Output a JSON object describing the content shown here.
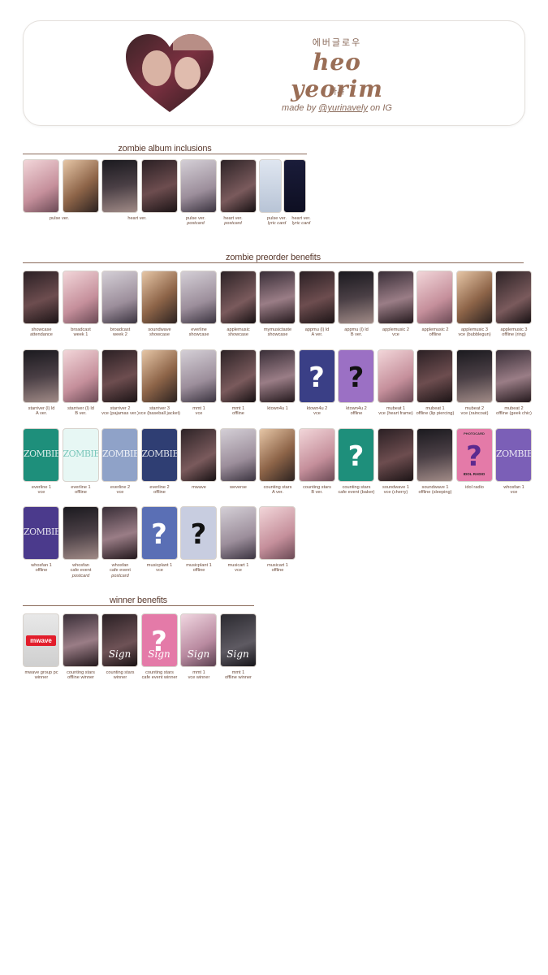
{
  "header": {
    "korean_top": "에버글로우",
    "name": "heo yeorim",
    "korean_bottom": "아샤",
    "made_by_prefix": "made by ",
    "made_by_handle": "@yurinavely",
    "made_by_suffix": " on IG"
  },
  "sections": {
    "album": "zombie album inclusions",
    "preorder": "zombie preorder benefits",
    "winner": "winner benefits"
  },
  "album_captions": [
    {
      "label": "pulse ver.",
      "sub": ""
    },
    {
      "label": "heart ver.",
      "sub": ""
    },
    {
      "label": "pulse ver.",
      "sub": "postcard"
    },
    {
      "label": "heart ver.",
      "sub": "postcard"
    },
    {
      "label": "pulse ver.",
      "sub": "lyric card"
    },
    {
      "label": "heart ver.",
      "sub": "lyric card"
    }
  ],
  "preorder_rows": [
    [
      {
        "l1": "showcase",
        "l2": "attendance"
      },
      {
        "l1": "broadcast",
        "l2": "week 1"
      },
      {
        "l1": "broadcast",
        "l2": "week 2"
      },
      {
        "l1": "soundwave",
        "l2": "showcase"
      },
      {
        "l1": "everline",
        "l2": "showcase"
      },
      {
        "l1": "applemusic",
        "l2": "showcase"
      },
      {
        "l1": "mymusictaste",
        "l2": "showcase"
      },
      {
        "l1": "appmu (l) ld",
        "l2": "A ver."
      },
      {
        "l1": "appmu (l) ld",
        "l2": "B ver."
      },
      {
        "l1": "applemusic 2",
        "l2": "vce"
      },
      {
        "l1": "applemusic 2",
        "l2": "offline"
      },
      {
        "l1": "applemusic 3",
        "l2": "vce (bubblegun)"
      },
      {
        "l1": "applemusic 3",
        "l2": "offline (ring)"
      }
    ],
    [
      {
        "l1": "starriver (l) ld",
        "l2": "A ver."
      },
      {
        "l1": "starriver (l) ld",
        "l2": "B ver."
      },
      {
        "l1": "starriver 2",
        "l2": "vce (pajamas ver.)"
      },
      {
        "l1": "starriver 3",
        "l2": "vce (baseball jacket)"
      },
      {
        "l1": "mmt 1",
        "l2": "vce"
      },
      {
        "l1": "mmt 1",
        "l2": "offline"
      },
      {
        "l1": "ktown4u 1",
        "l2": ""
      },
      {
        "l1": "ktown4u 2",
        "l2": "vce"
      },
      {
        "l1": "ktown4u 2",
        "l2": "offline"
      },
      {
        "l1": "mubeat 1",
        "l2": "vce (heart frame)"
      },
      {
        "l1": "mubeat 1",
        "l2": "offline (lip piercing)"
      },
      {
        "l1": "mubeat 2",
        "l2": "vce (raincoat)"
      },
      {
        "l1": "mubeat 2",
        "l2": "offline (geek chic)"
      }
    ],
    [
      {
        "l1": "everline 1",
        "l2": "vce"
      },
      {
        "l1": "everline 1",
        "l2": "offline"
      },
      {
        "l1": "everline 2",
        "l2": "vce"
      },
      {
        "l1": "everline 2",
        "l2": "offline"
      },
      {
        "l1": "mwave",
        "l2": ""
      },
      {
        "l1": "weverse",
        "l2": ""
      },
      {
        "l1": "counting stars",
        "l2": "A ver."
      },
      {
        "l1": "counting stars",
        "l2": "B ver."
      },
      {
        "l1": "counting stars",
        "l2": "cafe event (baker)"
      },
      {
        "l1": "soundwave 1",
        "l2": "vce (cherry)"
      },
      {
        "l1": "soundwave 1",
        "l2": "offline (sleeping)"
      },
      {
        "l1": "idol radio",
        "l2": ""
      },
      {
        "l1": "whosfan 1",
        "l2": "vce"
      }
    ],
    [
      {
        "l1": "whosfan 1",
        "l2": "offline"
      },
      {
        "l1": "whosfan",
        "l2": "cafe event",
        "l3": "postcard"
      },
      {
        "l1": "whosfan",
        "l2": "cafe event",
        "l3": "postcard"
      },
      {
        "l1": "musicplant 1",
        "l2": "vce"
      },
      {
        "l1": "musicplant 1",
        "l2": "offline"
      },
      {
        "l1": "musicart 1",
        "l2": "vce"
      },
      {
        "l1": "musicart 1",
        "l2": "offline"
      }
    ]
  ],
  "winner_captions": [
    {
      "l1": "mwave group pc",
      "l2": "winner"
    },
    {
      "l1": "counting stars",
      "l2": "offline winner"
    },
    {
      "l1": "counting stars",
      "l2": "winner"
    },
    {
      "l1": "counting stars",
      "l2": "cafe event winner"
    },
    {
      "l1": "mmt 1",
      "l2": "vce winner"
    },
    {
      "l1": "mmt 1",
      "l2": "offline winner"
    }
  ],
  "card_texts": {
    "question": "?",
    "zombie": "ZOMBIE",
    "sign": "Sign",
    "mwave": "mwave",
    "photocard": "PHOTOCARD",
    "idol_radio": "IDOL RADIO"
  },
  "colors": {
    "accent_brown": "#9a6e56",
    "rule_brown": "#8a6a5a",
    "teal": "#1e8f7b",
    "navy": "#2f3e73",
    "purple": "#7b5fb7",
    "pink": "#e47aa8",
    "question_navy": "#3a3f86",
    "question_violet": "#9b70c4"
  }
}
